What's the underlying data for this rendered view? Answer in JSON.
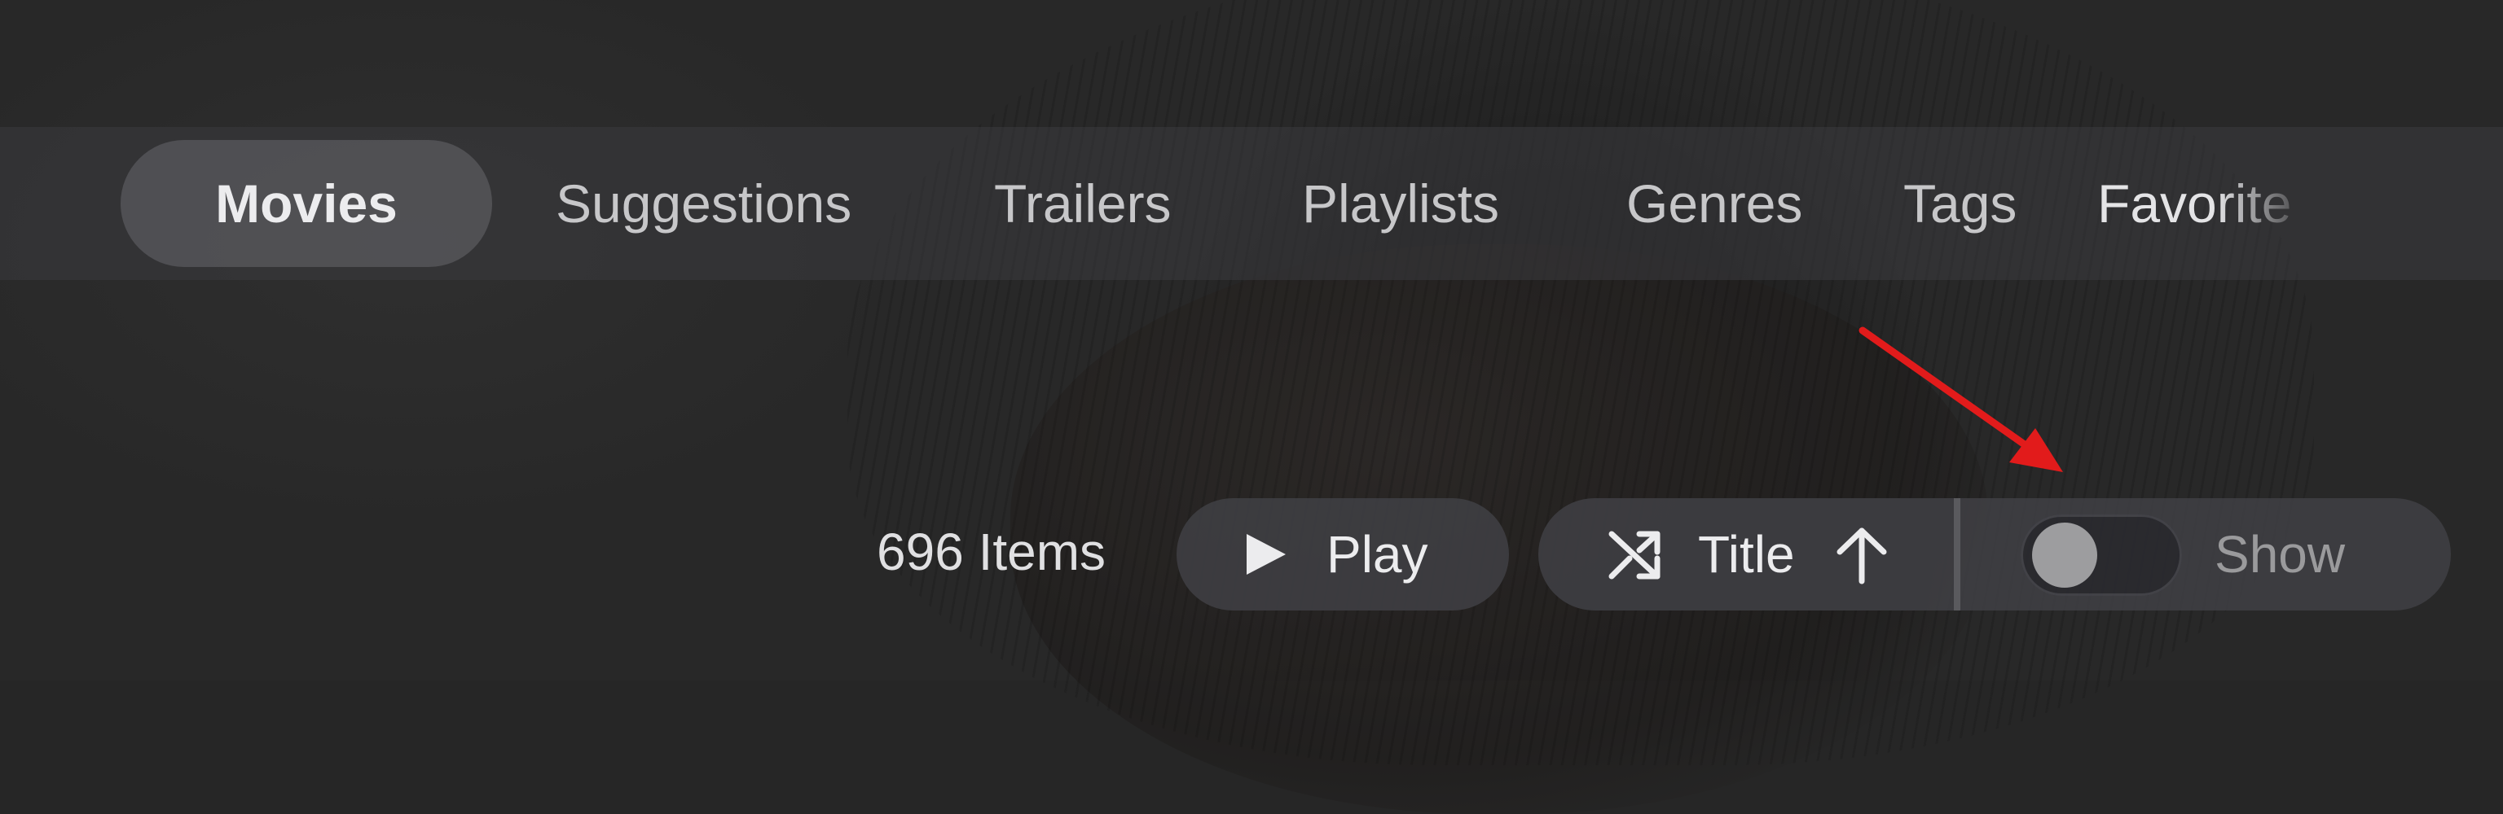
{
  "nav": {
    "tabs": [
      {
        "label": "Movies",
        "active": true
      },
      {
        "label": "Suggestions"
      },
      {
        "label": "Trailers"
      },
      {
        "label": "Playlists"
      },
      {
        "label": "Genres"
      },
      {
        "label": "Tags"
      },
      {
        "label": "Favorite"
      }
    ]
  },
  "toolbar": {
    "items_count": "696 Items",
    "play_label": "Play",
    "play_icon": "play-icon",
    "sort": {
      "shuffle_icon": "shuffle-icon",
      "label": "Title",
      "direction_icon": "arrow-up-icon"
    },
    "toggle": {
      "on": false
    },
    "show_label": "Show"
  },
  "colors": {
    "annotation_arrow": "#e21b1b",
    "pill_background": "#3e3e42",
    "text_primary": "#ececee"
  }
}
